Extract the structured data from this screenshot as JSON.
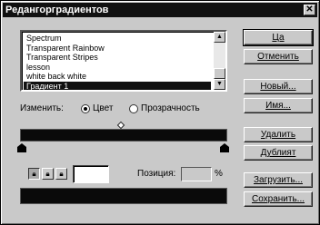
{
  "window": {
    "title": "Редангорградиентов",
    "close_glyph": "✕"
  },
  "gradient_list": {
    "items": [
      "Spectrum",
      "Transparent Rainbow",
      "Transparent Stripes",
      "lesson",
      "white back white",
      "Градиент 1"
    ],
    "selected_index": 5
  },
  "buttons": {
    "ok": "Ца",
    "cancel": "Отменить",
    "new": "Новый...",
    "rename": "Имя...",
    "delete": "Удалить",
    "duplicate": "Дублият",
    "load": "Загрузить...",
    "save": "Сохранить..."
  },
  "adjust": {
    "label": "Изменить:",
    "option_color": "Цвет",
    "option_transparency": "Прозрачность",
    "selected": "color"
  },
  "location": {
    "label": "Позиция:",
    "value": "",
    "unit": "%"
  },
  "colors": {
    "gradient_start": "#0a0a0a",
    "gradient_end": "#0a0a0a",
    "swatch": "#ffffff"
  },
  "icons": {
    "lock_1": "lock-icon",
    "lock_2": "lock-icon",
    "lock_3": "lock-icon"
  }
}
